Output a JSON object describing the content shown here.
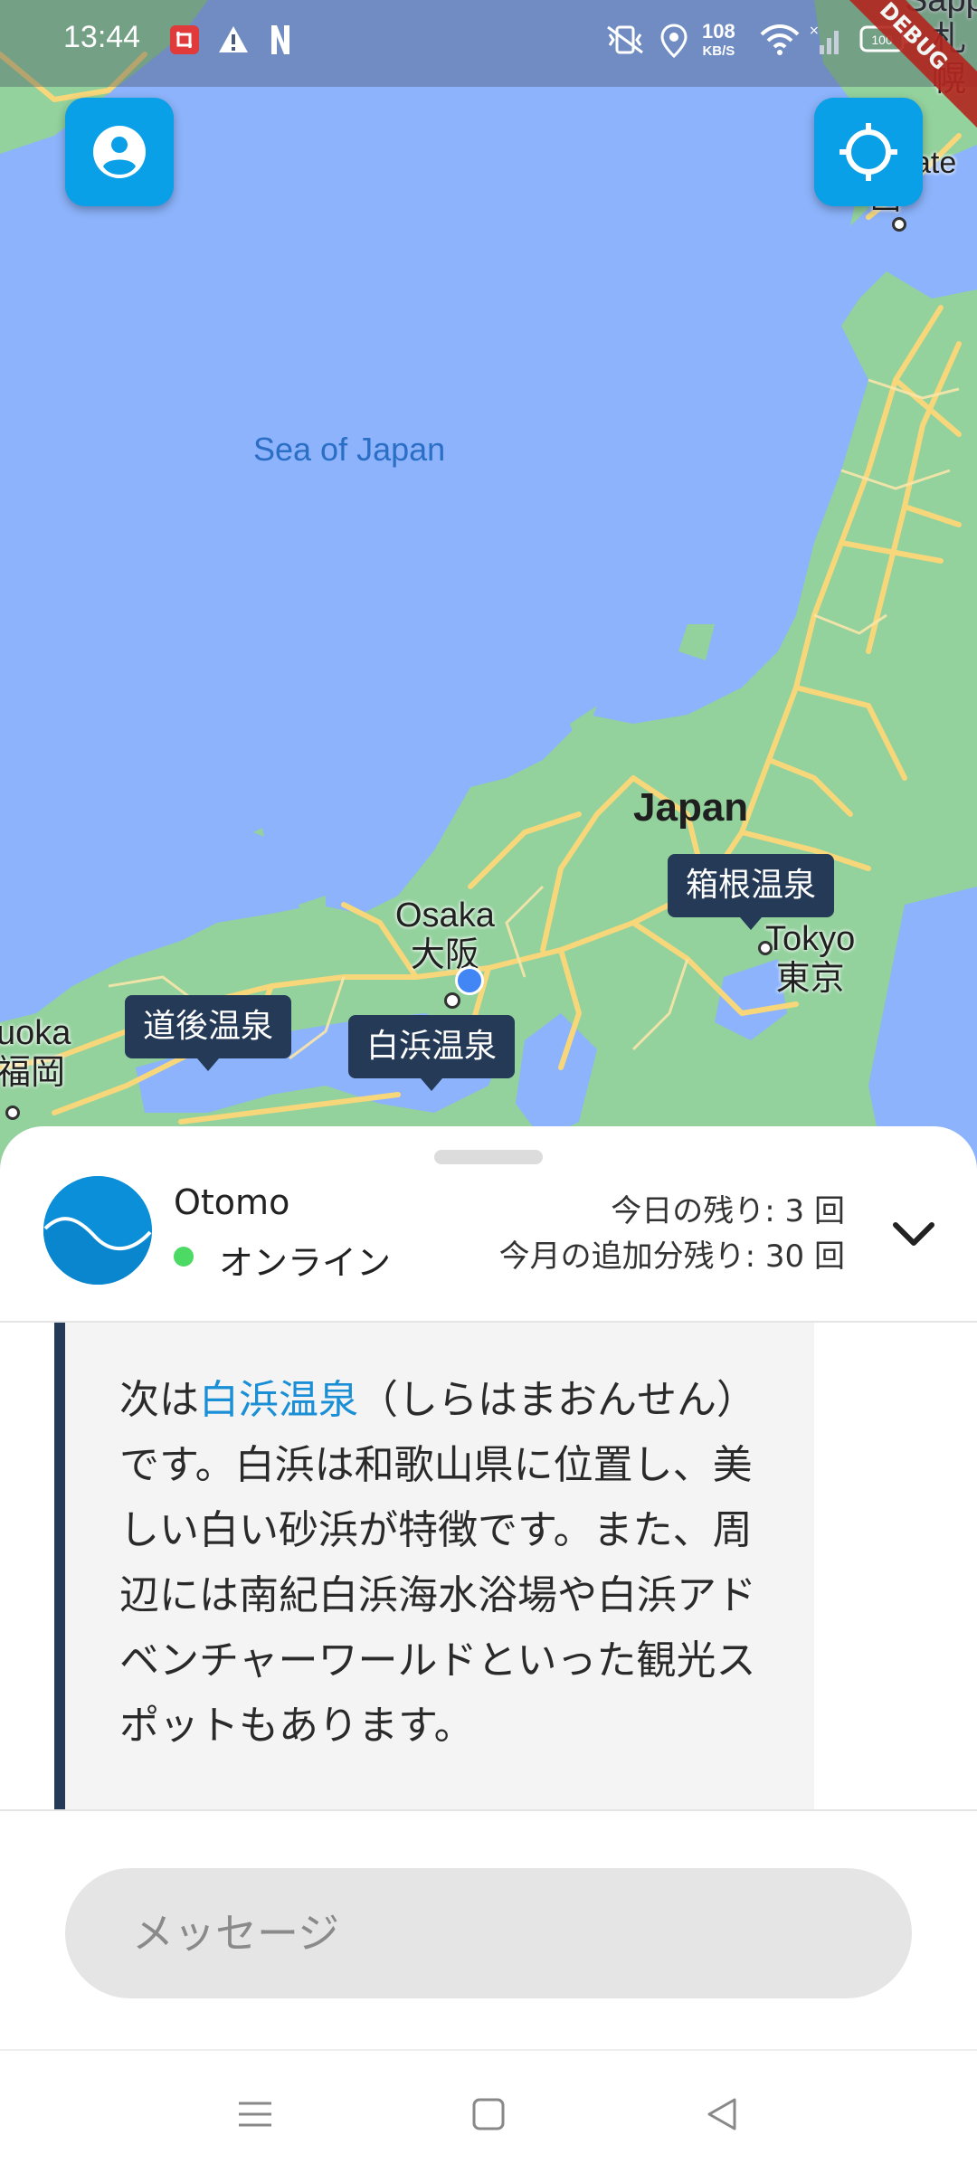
{
  "status_bar": {
    "time": "13:44",
    "network_speed_value": "108",
    "network_speed_unit": "KB/S",
    "battery": "100",
    "debug_banner": "DEBUG",
    "icons": [
      "screen-record-icon",
      "warning-icon",
      "n-app-icon",
      "vibrate-off-icon",
      "location-icon",
      "wifi-icon",
      "signal-icon",
      "battery-icon"
    ]
  },
  "map": {
    "sea_label": "Sea of Japan",
    "country_label": "Japan",
    "cities": [
      {
        "en": "Osaka",
        "ja": "大阪"
      },
      {
        "en": "Tokyo",
        "ja": "東京"
      },
      {
        "en": "uoka",
        "ja": "福岡"
      },
      {
        "en": "ate",
        "ja": "函"
      },
      {
        "en": "Sapp",
        "ja": "札幌"
      }
    ],
    "markers": [
      "箱根温泉",
      "道後温泉",
      "白浜温泉"
    ],
    "profile_button_icon": "profile-icon",
    "locate_button_icon": "my-location-icon"
  },
  "chat": {
    "bot_name": "Otomo",
    "status": "オンライン",
    "quota_today": "今日の残り: 3 回",
    "quota_month": "今月の追加分残り: 30 回",
    "message": {
      "prefix": "次は",
      "spot": "白浜温泉",
      "body": "（しらはまおんせん）です。白浜は和歌山県に位置し、美しい白い砂浜が特徴です。また、周辺には南紀白浜海水浴場や白浜アドベンチャーワールドといった観光スポットもあります。"
    },
    "input_placeholder": "メッセージ"
  },
  "navbar": {
    "icons": [
      "menu-icon",
      "home-square-icon",
      "back-triangle-icon"
    ]
  },
  "colors": {
    "sea": "#8cb3fb",
    "land": "#93d19d",
    "road": "#f7d77a",
    "marker": "#243a56",
    "accent": "#0aa0e8",
    "link": "#1a8fd6",
    "online": "#4cd964"
  }
}
